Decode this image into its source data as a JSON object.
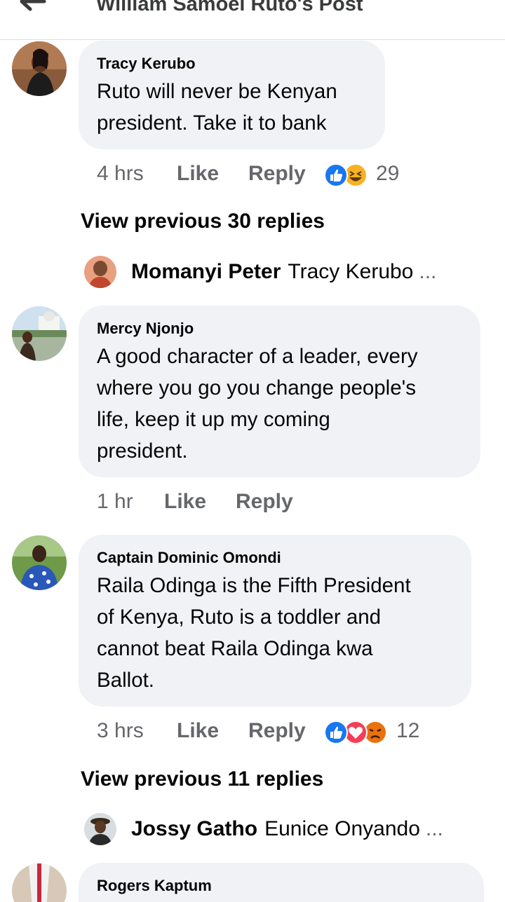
{
  "header": {
    "title": "William Samoei Ruto's Post"
  },
  "comments": [
    {
      "author": "Tracy Kerubo",
      "lines": [
        "Ruto will never be Kenyan",
        "president. Take it to bank"
      ],
      "time": "4 hrs",
      "like_label": "Like",
      "reply_label": "Reply",
      "reactions": [
        "like",
        "haha"
      ],
      "reaction_count": "29",
      "view_previous": "View previous 30 replies",
      "latest_reply": {
        "name": "Momanyi Peter",
        "text": "Tracy Kerubo",
        "ellipsis": "..."
      }
    },
    {
      "author": "Mercy Njonjo",
      "lines": [
        "A good character of a leader, every",
        "where you go you change people's",
        "life, keep it up my coming",
        "president."
      ],
      "time": "1 hr",
      "like_label": "Like",
      "reply_label": "Reply"
    },
    {
      "author": "Captain Dominic Omondi",
      "lines": [
        "Raila Odinga is the Fifth President",
        "of Kenya, Ruto is a toddler and",
        "cannot beat Raila Odinga kwa",
        "Ballot."
      ],
      "time": "3 hrs",
      "like_label": "Like",
      "reply_label": "Reply",
      "reactions": [
        "like",
        "love",
        "angry"
      ],
      "reaction_count": "12",
      "view_previous": "View previous 11 replies",
      "latest_reply": {
        "name": "Jossy Gatho",
        "text": "Eunice Onyando",
        "ellipsis": "..."
      }
    },
    {
      "author": "Rogers Kaptum"
    }
  ],
  "colors": {
    "like": "#1877f2",
    "love": "#f33e58",
    "haha": "#f7b125",
    "angry": "#e9710f",
    "bubble": "#f0f2f5",
    "meta": "#65676b"
  }
}
